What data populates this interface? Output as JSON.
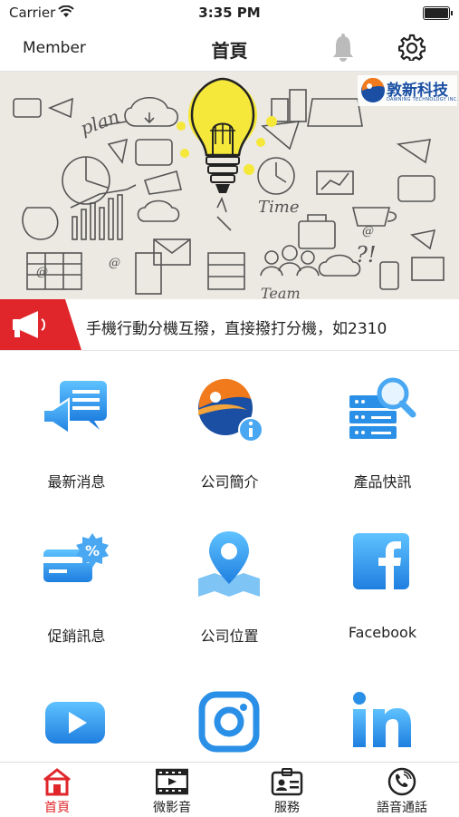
{
  "status_bar": {
    "carrier": "Carrier",
    "time": "3:35 PM"
  },
  "nav": {
    "left_label": "Member",
    "title": "首頁",
    "icons": [
      "bell-icon",
      "gear-icon"
    ]
  },
  "banner": {
    "logo_text": "敦新科技",
    "logo_subtext": "DAWNING TECHNOLOGY INC.",
    "doodle_words": [
      "plan",
      "Time",
      "Team",
      "?!"
    ]
  },
  "announcement": {
    "text": "手機行動分機互撥，直接撥打分機，如2310",
    "icon": "megaphone-icon"
  },
  "menu": [
    {
      "label": "最新消息",
      "icon": "news-megaphone-icon"
    },
    {
      "label": "公司簡介",
      "icon": "company-logo-info-icon"
    },
    {
      "label": "產品快訊",
      "icon": "server-search-icon"
    },
    {
      "label": "促銷訊息",
      "icon": "discount-card-icon"
    },
    {
      "label": "公司位置",
      "icon": "map-pin-icon"
    },
    {
      "label": "Facebook",
      "icon": "facebook-icon"
    },
    {
      "label": "",
      "icon": "youtube-icon"
    },
    {
      "label": "",
      "icon": "instagram-icon"
    },
    {
      "label": "",
      "icon": "linkedin-icon"
    }
  ],
  "tabs": [
    {
      "label": "首頁",
      "icon": "home-icon",
      "active": true
    },
    {
      "label": "微影音",
      "icon": "film-icon",
      "active": false
    },
    {
      "label": "服務",
      "icon": "id-card-icon",
      "active": false
    },
    {
      "label": "語音通話",
      "icon": "phone-call-icon",
      "active": false
    }
  ],
  "colors": {
    "accent_red": "#e0262b",
    "icon_blue": "#2a8fe6",
    "logo_blue": "#1a4fa3",
    "bulb_yellow": "#f5e83a"
  }
}
